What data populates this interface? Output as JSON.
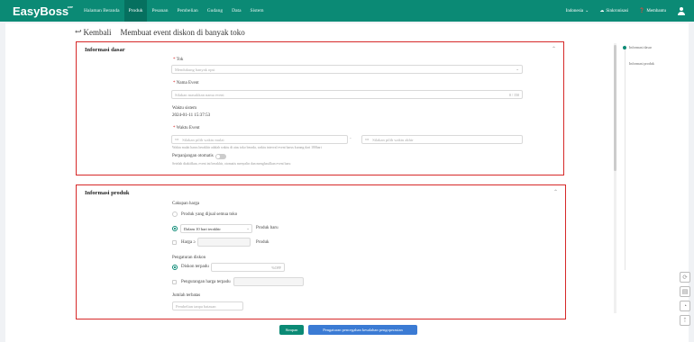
{
  "brand": {
    "logo": "EasyBoss",
    "logo_sup": "ERP"
  },
  "nav": [
    "Halaman Beranda",
    "Produk",
    "Pesanan",
    "Pembelian",
    "Gudang",
    "Data",
    "Sistem"
  ],
  "top_right": {
    "language": "Indonesia",
    "auth": "Sinkronisasi",
    "help": "Membantu"
  },
  "header": {
    "back_label": "Kembali",
    "title": "Membuat event diskon di banyak toko"
  },
  "right_nav": [
    "Informasi dasar",
    "Informasi produk"
  ],
  "basic": {
    "title": "Informasi dasar",
    "store_label": "Tok",
    "store_placeholder": "Mendukung banyak opsi",
    "event_name_label": "Nama Event",
    "event_name_placeholder": "Silakan masukkan nama event",
    "event_name_counter": "0 / 150",
    "system_time_label": "Waktu sistem",
    "system_time_value": "2024-01-11 15:37:53",
    "event_time_label": "Waktu Event",
    "start_placeholder": "Silakan pilih waktu mulai",
    "end_placeholder": "Silakan pilih waktu akhir",
    "time_hint": "Waktu mulai harus berakhir adalah waktu di atas toko berada, waktu interval event harus kurang dari 180hari",
    "auto_extend_label": "Perpanjangan otomatis",
    "auto_extend_hint": "Setelah diaktifkan, event ini berakhir, otomatis menyalin dan menghasilkan event baru"
  },
  "product": {
    "title": "Informasi produk",
    "price_scope_label": "Cakupan harga",
    "opt_all": "Produk yang dijual semua toko",
    "opt_within_select": "Dalam 10 hari terakhir",
    "opt_within_suffix": "Produk baru",
    "opt_price_label": "Harga ≥",
    "opt_price_suffix": "Produk",
    "discount_label": "Pengaturan diskon",
    "disc_unified": "Diskon terpadu",
    "disc_unified_suffix": "%OFF",
    "disc_reduce": "Pengurangan harga terpadu",
    "limit_label": "Jumlah terbatas",
    "limit_placeholder": "Pembelian tanpa batasan"
  },
  "footer": {
    "save": "Simpan",
    "settings": "Pengaturan pencegahan kesalahan pengoperasian"
  },
  "colors": {
    "brand": "#0b8a75",
    "highlight": "#d62828",
    "secondary_btn": "#3b7bd4"
  }
}
